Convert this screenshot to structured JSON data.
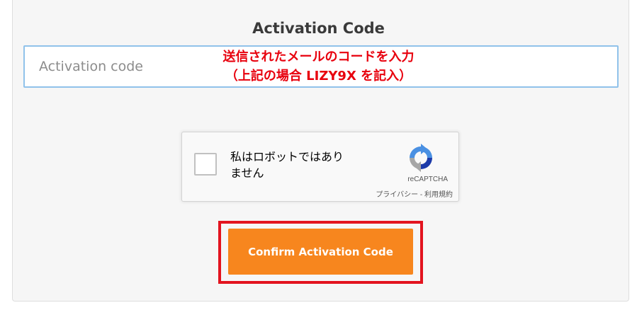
{
  "form": {
    "title": "Activation Code",
    "input": {
      "placeholder": "Activation code",
      "value": ""
    },
    "annotation": {
      "line1": "送信されたメールのコードを入力",
      "line2": "（上記の場合 LIZY9X を記入）",
      "color": "#e8000d"
    }
  },
  "captcha": {
    "label_line1": "私はロボットではあり",
    "label_line2": "ません",
    "brand": "reCAPTCHA",
    "links": "プライバシー - 利用規約",
    "checked": false
  },
  "confirm": {
    "label": "Confirm Activation Code",
    "color": "#f7861e",
    "highlight_color": "#e3141f"
  }
}
